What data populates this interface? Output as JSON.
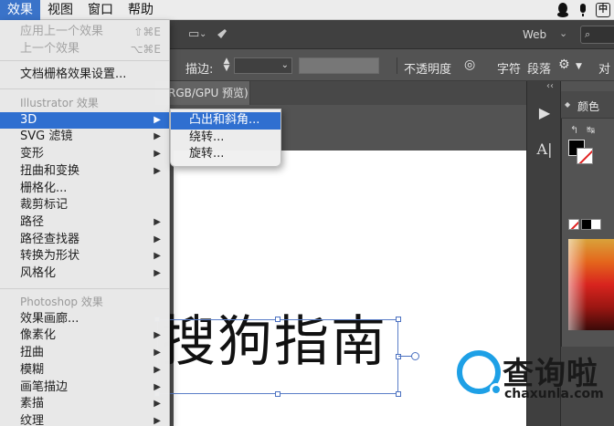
{
  "menubar": {
    "items": [
      "效果",
      "视图",
      "窗口",
      "帮助"
    ],
    "tray_zh": "中"
  },
  "appbar": {
    "workspace": "Web",
    "search_prefix": "⌕"
  },
  "controlbar": {
    "stroke_label": "描边:",
    "opacity_label": "不透明度",
    "char_label": "字符",
    "para_label": "段落",
    "align_label": "对"
  },
  "document": {
    "tab_title": "RGB/GPU 预览)",
    "canvas_text": "搜狗指南"
  },
  "panel": {
    "color_tab": "颜色"
  },
  "watermark": {
    "title": "查询啦",
    "url": "chaxunla.com"
  },
  "effects_menu": {
    "apply_last": "应用上一个效果",
    "apply_last_shortcut": "⇧⌘E",
    "last_effect": "上一个效果",
    "last_effect_shortcut": "⌥⌘E",
    "raster_settings": "文档栅格效果设置...",
    "illustrator_header": "Illustrator 效果",
    "illustrator_items": [
      "3D",
      "SVG 滤镜",
      "变形",
      "扭曲和变换",
      "栅格化...",
      "裁剪标记",
      "路径",
      "路径查找器",
      "转换为形状",
      "风格化"
    ],
    "photoshop_header": "Photoshop 效果",
    "photoshop_items": [
      "效果画廊...",
      "像素化",
      "扭曲",
      "模糊",
      "画笔描边",
      "素描",
      "纹理"
    ]
  },
  "submenu_3d": {
    "items": [
      "凸出和斜角...",
      "绕转...",
      "旋转..."
    ]
  }
}
